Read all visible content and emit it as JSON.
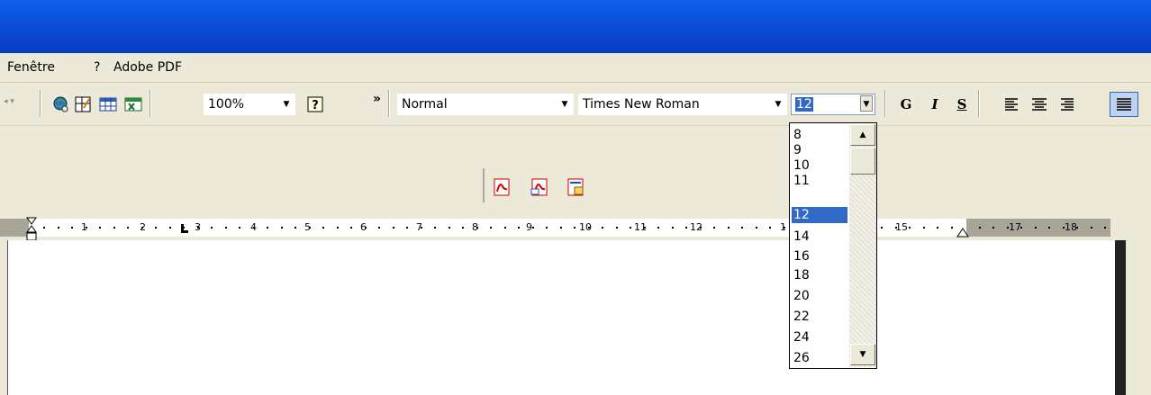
{
  "menubar": {
    "items": [
      "Fenêtre",
      "?",
      "Adobe PDF"
    ]
  },
  "toolbar": {
    "zoom_value": "100%",
    "overflow_glyph": "»",
    "style_value": "Normal",
    "font_value": "Times New Roman",
    "size_value": "12",
    "bold_label": "G",
    "italic_label": "I",
    "underline_label": "S"
  },
  "ruler": {
    "numbers": [
      "1",
      "2",
      "3",
      "4",
      "5",
      "6",
      "7",
      "8",
      "9",
      "10",
      "11",
      "12",
      "1",
      "15",
      "17",
      "18"
    ]
  },
  "fontsize_dropdown": {
    "options": [
      "8",
      "9",
      "10",
      "11",
      "12",
      "14",
      "16",
      "18",
      "20",
      "22",
      "24",
      "26"
    ],
    "selected": "12"
  },
  "colors": {
    "titlebar": "#0a4fd8",
    "selection": "#316ac5",
    "chrome": "#ece9d8"
  },
  "icons": [
    "web-globe-icon",
    "edit-frame-icon",
    "table-icon",
    "excel-sheet-icon",
    "help-icon",
    "pdf-convert-icon",
    "pdf-email-icon",
    "pdf-review-icon"
  ]
}
